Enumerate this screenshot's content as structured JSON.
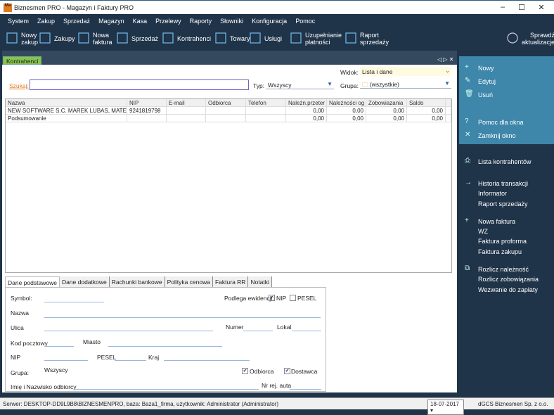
{
  "window": {
    "title": "Biznesmen PRO - Magazyn i Faktury PRO",
    "logo": "Ma"
  },
  "menu": [
    "System",
    "Zakup",
    "Sprzedaż",
    "Magazyn",
    "Kasa",
    "Przelewy",
    "Raporty",
    "Słowniki",
    "Konfiguracja",
    "Pomoc"
  ],
  "toolbar": [
    {
      "l1": "Nowy",
      "l2": "zakup",
      "icon": "new-purchase-icon"
    },
    {
      "l1": "Zakupy",
      "l2": "",
      "icon": "document-icon"
    },
    {
      "l1": "Nowa",
      "l2": "faktura",
      "icon": "new-invoice-icon"
    },
    {
      "l1": "Sprzedaż",
      "l2": "",
      "icon": "document-icon"
    },
    {
      "l1": "Kontrahenci",
      "l2": "",
      "icon": "user-icon"
    },
    {
      "l1": "Towary",
      "l2": "",
      "icon": "bag-icon"
    },
    {
      "l1": "Usługi",
      "l2": "",
      "icon": "pencil-icon"
    },
    {
      "l1": "Uzupełnianie",
      "l2": "płatności",
      "icon": "external-icon"
    },
    {
      "l1": "Raport",
      "l2": "sprzedaży",
      "icon": "chart-icon"
    }
  ],
  "update": {
    "l1": "Sprawdź",
    "l2": "aktualizacje"
  },
  "tab": "Kontrahenci",
  "filters": {
    "search_label": "Szukaj:",
    "search_value": "",
    "typ_label": "Typ:",
    "typ_value": "Wszyscy",
    "widok_label": "Widok:",
    "widok_value": "Lista i dane",
    "grupa_label": "Grupa:",
    "grupa_value": "(wszystkie)"
  },
  "grid": {
    "columns": [
      "Nazwa",
      "NIP",
      "E-mail",
      "Odbiorca",
      "Telefon",
      "Należn.przeter",
      "Należności og",
      "Zobowiazania",
      "Saldo"
    ],
    "rows": [
      [
        "NEW SOFTWARE S.C. MAREK LUBAS, MATEUS",
        "9241819798",
        "",
        "",
        "",
        "0,00",
        "0,00",
        "0,00",
        "0,00"
      ],
      [
        "Podsumowanie",
        "",
        "",
        "",
        "",
        "0,00",
        "0,00",
        "0,00",
        "0,00"
      ]
    ]
  },
  "form_tabs": [
    "Dane podstawowe",
    "Dane dodatkowe",
    "Rachunki bankowe",
    "Polityka cenowa",
    "Faktura RR",
    "Notatki"
  ],
  "form": {
    "symbol": "Symbol:",
    "podlega": "Podlega ewidencji:",
    "nip_chk": "NIP",
    "pesel_chk": "PESEL",
    "nazwa": "Nazwa",
    "ulica": "Ulica",
    "numer": "Numer",
    "lokal": "Lokal",
    "kod": "Kod pocztowy",
    "miasto": "Miasto",
    "nip": "NIP",
    "pesel": "PESEL",
    "kraj": "Kraj",
    "grupa": "Grupa:",
    "grupa_value": "Wszyscy",
    "odbiorca": "Odbiorca",
    "dostawca": "Dostawca",
    "imie": "Imię i Nazwisko odbiorcy",
    "nrrej": "Nr rej. auta",
    "nip_checked": true,
    "pesel_checked": false,
    "odbiorca_checked": true,
    "dostawca_checked": true
  },
  "actions_top": [
    {
      "label": "Nowy",
      "icon": "plus-icon"
    },
    {
      "label": "Edytuj",
      "icon": "edit-icon"
    },
    {
      "label": "Usuń",
      "icon": "trash-icon"
    },
    {
      "label": "Pomoc dla okna",
      "icon": "help-icon"
    },
    {
      "label": "Zamknij okno",
      "icon": "close-icon"
    }
  ],
  "actions": [
    {
      "label": "Lista kontrahentów",
      "icon": "printer-icon"
    },
    {
      "label": "Historia transakcji",
      "icon": "arrow-right-icon"
    },
    {
      "label": "Informator"
    },
    {
      "label": "Raport sprzedaży"
    },
    {
      "label": "Nowa faktura",
      "icon": "plus-icon"
    },
    {
      "label": "WZ"
    },
    {
      "label": "Faktura proforma"
    },
    {
      "label": "Faktura zakupu"
    },
    {
      "label": "Rozlicz należność",
      "icon": "external-icon"
    },
    {
      "label": "Rozlicz zobowiązania"
    },
    {
      "label": "Wezwanie do zapłaty"
    }
  ],
  "status": {
    "text": "Serwer: DESKTOP-DD9L9B8\\BIZNESMENPRO, baza: Baza1_firma, użytkownik: Administrator (Administrator)",
    "date": "18-07-2017",
    "company": "dGCS Biznesmen Sp. z o.o."
  },
  "colors": {
    "dark": "#1f3349",
    "panel": "#3e86aa",
    "tab": "#8bc34a",
    "search_label": "#e07b1f"
  }
}
